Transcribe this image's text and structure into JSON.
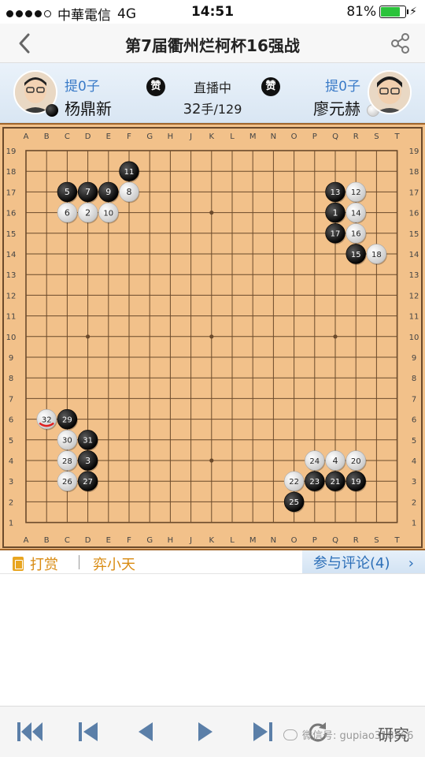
{
  "status_bar": {
    "carrier": "中華電信",
    "network": "4G",
    "time": "14:51",
    "battery": "81%",
    "battery_level": 0.81
  },
  "nav": {
    "title": "第7届衢州烂柯杯16强战"
  },
  "players": {
    "black": {
      "name": "杨鼎新",
      "captures": "提0子"
    },
    "white": {
      "name": "廖元赫",
      "captures": "提0子"
    },
    "zan_left": "赞",
    "zan_right": "赞",
    "live_status": "直播中",
    "move_current": "32",
    "move_unit": "手",
    "move_total": "/129"
  },
  "board": {
    "size": 19,
    "columns": [
      "A",
      "B",
      "C",
      "D",
      "E",
      "F",
      "G",
      "H",
      "J",
      "K",
      "L",
      "M",
      "N",
      "O",
      "P",
      "Q",
      "R",
      "S",
      "T"
    ],
    "rows": [
      "19",
      "18",
      "17",
      "16",
      "15",
      "14",
      "13",
      "12",
      "11",
      "10",
      "9",
      "8",
      "7",
      "6",
      "5",
      "4",
      "3",
      "2",
      "1"
    ],
    "colors": {
      "board": "#f2c18a",
      "line": "#6b4a2b",
      "label": "#444444",
      "last_move_mark": "#e02020"
    },
    "stones": [
      {
        "col": "Q",
        "row": 16,
        "color": "black",
        "move": "1"
      },
      {
        "col": "D",
        "row": 16,
        "color": "white",
        "move": "2"
      },
      {
        "col": "D",
        "row": 4,
        "color": "black",
        "move": "3"
      },
      {
        "col": "Q",
        "row": 4,
        "color": "white",
        "move": "4"
      },
      {
        "col": "C",
        "row": 17,
        "color": "black",
        "move": "5"
      },
      {
        "col": "C",
        "row": 16,
        "color": "white",
        "move": "6"
      },
      {
        "col": "D",
        "row": 17,
        "color": "black",
        "move": "7"
      },
      {
        "col": "F",
        "row": 17,
        "color": "white",
        "move": "8"
      },
      {
        "col": "E",
        "row": 17,
        "color": "black",
        "move": "9"
      },
      {
        "col": "E",
        "row": 16,
        "color": "white",
        "move": "10"
      },
      {
        "col": "F",
        "row": 18,
        "color": "black",
        "move": "11"
      },
      {
        "col": "R",
        "row": 17,
        "color": "white",
        "move": "12"
      },
      {
        "col": "Q",
        "row": 17,
        "color": "black",
        "move": "13"
      },
      {
        "col": "R",
        "row": 16,
        "color": "white",
        "move": "14"
      },
      {
        "col": "R",
        "row": 14,
        "color": "black",
        "move": "15"
      },
      {
        "col": "R",
        "row": 15,
        "color": "white",
        "move": "16"
      },
      {
        "col": "Q",
        "row": 15,
        "color": "black",
        "move": "17"
      },
      {
        "col": "S",
        "row": 14,
        "color": "white",
        "move": "18"
      },
      {
        "col": "R",
        "row": 3,
        "color": "black",
        "move": "19"
      },
      {
        "col": "R",
        "row": 4,
        "color": "white",
        "move": "20"
      },
      {
        "col": "Q",
        "row": 3,
        "color": "black",
        "move": "21"
      },
      {
        "col": "O",
        "row": 3,
        "color": "white",
        "move": "22"
      },
      {
        "col": "P",
        "row": 3,
        "color": "black",
        "move": "23"
      },
      {
        "col": "P",
        "row": 4,
        "color": "white",
        "move": "24"
      },
      {
        "col": "O",
        "row": 2,
        "color": "black",
        "move": "25"
      },
      {
        "col": "C",
        "row": 3,
        "color": "white",
        "move": "26"
      },
      {
        "col": "D",
        "row": 3,
        "color": "black",
        "move": "27"
      },
      {
        "col": "C",
        "row": 4,
        "color": "white",
        "move": "28"
      },
      {
        "col": "C",
        "row": 6,
        "color": "black",
        "move": "29"
      },
      {
        "col": "C",
        "row": 5,
        "color": "white",
        "move": "30"
      },
      {
        "col": "D",
        "row": 5,
        "color": "black",
        "move": "31"
      },
      {
        "col": "B",
        "row": 6,
        "color": "white",
        "move": "32",
        "last": true
      }
    ],
    "star_points": [
      [
        "D",
        "16"
      ],
      [
        "K",
        "16"
      ],
      [
        "Q",
        "16"
      ],
      [
        "D",
        "10"
      ],
      [
        "K",
        "10"
      ],
      [
        "Q",
        "10"
      ],
      [
        "D",
        "4"
      ],
      [
        "K",
        "4"
      ],
      [
        "Q",
        "4"
      ]
    ]
  },
  "actions": {
    "reward": "打赏",
    "commentator": "弈小天",
    "comments": "参与评论(4)"
  },
  "toolbar": {
    "buttons": [
      "first-move",
      "previous-five",
      "previous",
      "next",
      "last-move"
    ],
    "refresh_icon": "refresh-icon",
    "research": "研究",
    "watermark": "微信号: gupiao318866"
  }
}
